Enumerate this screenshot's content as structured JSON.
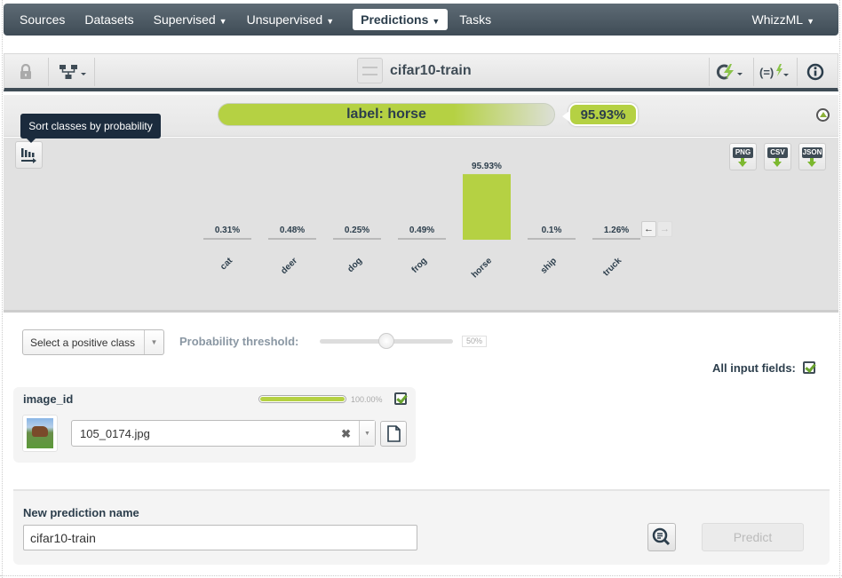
{
  "nav": {
    "items": [
      {
        "label": "Sources",
        "caret": false
      },
      {
        "label": "Datasets",
        "caret": false
      },
      {
        "label": "Supervised",
        "caret": true
      },
      {
        "label": "Unsupervised",
        "caret": true
      },
      {
        "label": "Predictions",
        "caret": true,
        "active": true
      },
      {
        "label": "Tasks",
        "caret": false
      }
    ],
    "right_item": {
      "label": "WhizzML",
      "caret": true
    },
    "caret_glyph": "▼"
  },
  "toolbar": {
    "title": "cifar10-train",
    "left_icons": [
      "lock-icon",
      "model-tree-icon"
    ],
    "right_icons": [
      "batch-predict-icon",
      "script-icon",
      "info-icon"
    ]
  },
  "result": {
    "label_text": "label: horse",
    "probability": "95.93%"
  },
  "tooltip": {
    "text": "Sort classes by probability"
  },
  "exports": [
    {
      "label": "PNG"
    },
    {
      "label": "CSV"
    },
    {
      "label": "JSON"
    }
  ],
  "chart_data": {
    "type": "bar",
    "title": "",
    "xlabel": "",
    "ylabel": "",
    "categories": [
      "cat",
      "deer",
      "dog",
      "frog",
      "horse",
      "ship",
      "truck"
    ],
    "values": [
      0.31,
      0.48,
      0.25,
      0.49,
      95.93,
      0.1,
      1.26
    ],
    "value_labels": [
      "0.31%",
      "0.48%",
      "0.25%",
      "0.49%",
      "95.93%",
      "0.1%",
      "1.26%"
    ],
    "highlighted": "horse",
    "ylim": [
      0,
      100
    ],
    "grid": false,
    "colors": {
      "highlight": "#b5d143",
      "base": "#b9b9b9"
    }
  },
  "chart_nav": {
    "prev": "←",
    "next": "→"
  },
  "controls": {
    "positive_class_placeholder": "Select a positive class",
    "threshold_label": "Probability threshold:",
    "threshold_value": "50%",
    "threshold_fraction": 0.5,
    "all_fields_label": "All input fields:",
    "all_fields_checked": true
  },
  "field": {
    "name": "image_id",
    "importance_text": "100.00%",
    "importance_fraction": 1.0,
    "checked": true,
    "value": "105_0174.jpg",
    "clear_glyph": "✖",
    "dd_glyph": "▼"
  },
  "prediction_name": {
    "label": "New prediction name",
    "value": "cifar10-train",
    "predict_label": "Predict"
  }
}
